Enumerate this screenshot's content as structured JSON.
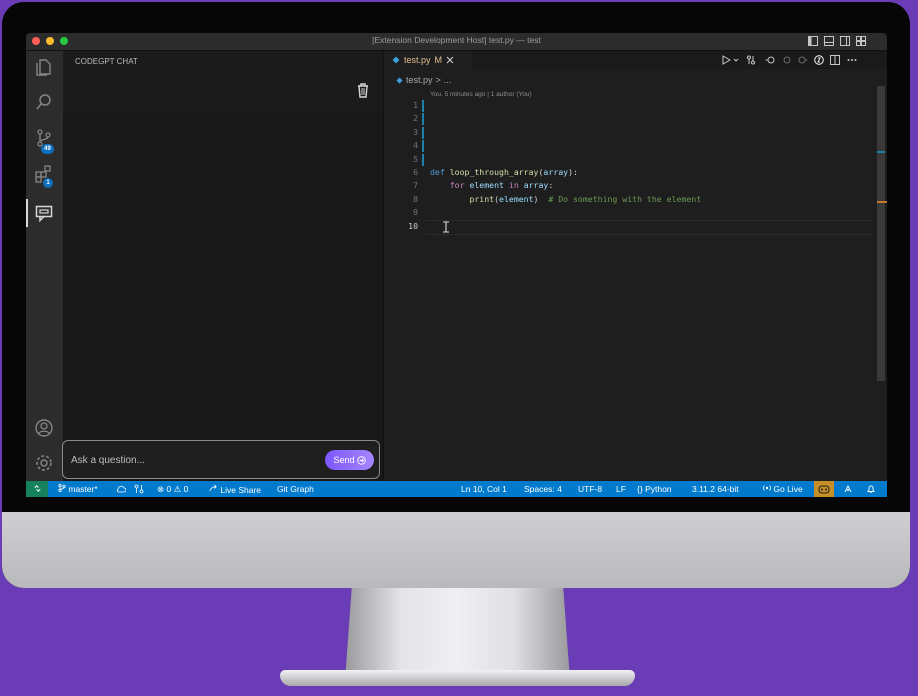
{
  "window": {
    "title": "[Extension Development Host] test.py — test"
  },
  "activity_bar": {
    "source_control_badge": "49",
    "extensions_badge": "1"
  },
  "sidebar": {
    "title": "CODEGPT CHAT",
    "input_placeholder": "Ask a question...",
    "send_label": "Send"
  },
  "editor": {
    "tab": {
      "filename": "test.py",
      "status": "M"
    },
    "breadcrumb": {
      "file": "test.py",
      "sep": ">",
      "more": "..."
    },
    "blame": "You, 5 minutes ago | 1 author (You)",
    "lines": [
      {
        "n": "1",
        "text": ""
      },
      {
        "n": "2",
        "text": ""
      },
      {
        "n": "3",
        "text": ""
      },
      {
        "n": "4",
        "text": ""
      },
      {
        "n": "5",
        "text": ""
      },
      {
        "n": "6",
        "text": "def loop_through_array(array):"
      },
      {
        "n": "7",
        "text": "for element in array:"
      },
      {
        "n": "8",
        "text": "print(element)  # Do something with the element"
      },
      {
        "n": "9",
        "text": ""
      },
      {
        "n": "10",
        "text": ""
      }
    ],
    "current_line": "10"
  },
  "status_bar": {
    "branch": "master*",
    "errors": "0",
    "warnings": "0",
    "live_share": "Live Share",
    "git_graph": "Git Graph",
    "cursor": "Ln 10, Col 1",
    "spaces": "Spaces: 4",
    "encoding": "UTF-8",
    "eol": "LF",
    "language": "Python",
    "interpreter": "3.11.2 64-bit",
    "go_live": "Go Live"
  },
  "colors": {
    "background": "#6a3cb5",
    "status_bar": "#007acc",
    "send_button": "#8b6bff"
  }
}
